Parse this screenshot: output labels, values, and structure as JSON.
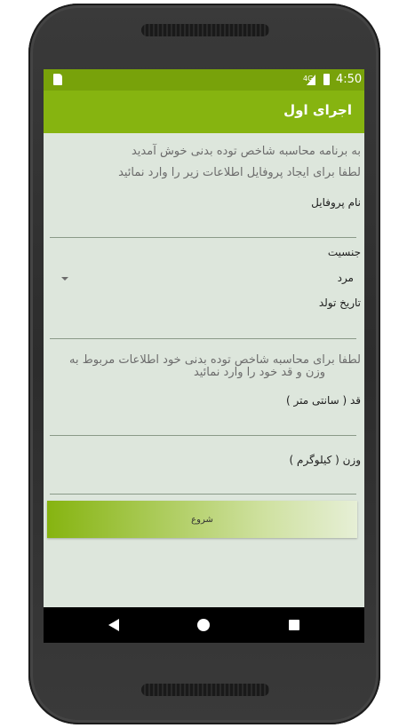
{
  "status_bar": {
    "time": "4:50",
    "network": "4G"
  },
  "app_bar": {
    "title": "اجرای اول"
  },
  "welcome": {
    "line1": "به برنامه محاسبه شاخص توده بدنی خوش آمدید",
    "line2": "لطفا برای ایجاد پروفایل اطلاعات زیر را وارد نمائید"
  },
  "profile_name": {
    "label": "نام پروفایل",
    "value": ""
  },
  "gender": {
    "label": "جنسیت",
    "selected": "مرد"
  },
  "birth_date": {
    "label": "تاریخ تولد",
    "value": ""
  },
  "info": {
    "line1": "لطفا برای محاسبه شاخص توده بدنی خود اطلاعات مربوط به",
    "line2": "وزن و قد خود را وارد نمائید"
  },
  "height": {
    "label": "قد ( سانتی متر )",
    "value": ""
  },
  "weight": {
    "label": "وزن ( کیلوگرم )",
    "value": ""
  },
  "start_button": {
    "label": "شروع"
  },
  "colors": {
    "status_bar": "#78a20a",
    "app_bar": "#86b410",
    "background": "#dde6dc"
  },
  "icons": {
    "nav": [
      "back-icon",
      "home-icon",
      "recent-apps-icon"
    ]
  }
}
